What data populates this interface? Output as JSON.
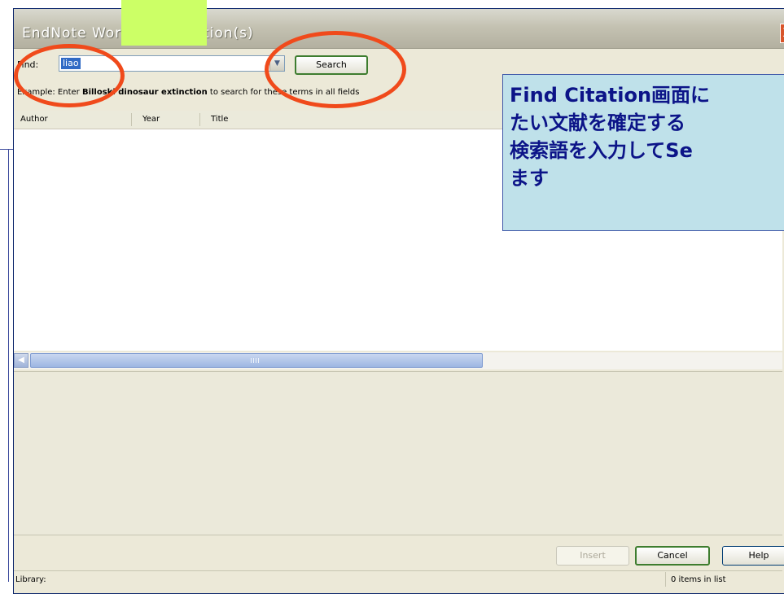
{
  "window": {
    "title": "EndNote Word Find Citation(s)",
    "close_glyph": "X"
  },
  "search": {
    "find_label": "Find:",
    "find_value": "liao",
    "search_button": "Search",
    "example_prefix": "Example: Enter ",
    "example_terms": "Billoski dinosaur extinction",
    "example_suffix": " to search for these terms in all fields"
  },
  "list": {
    "columns": [
      "Author",
      "Year",
      "Title"
    ]
  },
  "buttons": {
    "insert": "Insert",
    "cancel": "Cancel",
    "help": "Help"
  },
  "status": {
    "library": "Library:",
    "count": "0 items in list"
  },
  "callout": {
    "lines": [
      "Find Citation画面に",
      "たい文献を確定する",
      "検索語を入力してSe",
      "ます"
    ]
  },
  "colors": {
    "highlight_ring": "#f04a1b",
    "callout_bg": "#bfe1ea",
    "callout_text": "#0c1488",
    "green_patch": "#ccff66"
  },
  "icons": {
    "dropdown": "chevron-down-icon",
    "scroll_left": "arrow-left-icon",
    "close": "close-icon"
  }
}
